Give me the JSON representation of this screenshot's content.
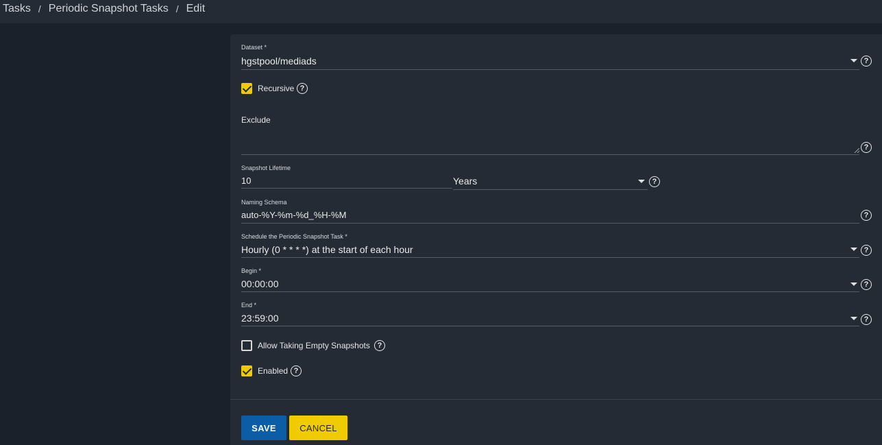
{
  "breadcrumb": {
    "items": [
      "Tasks",
      "Periodic Snapshot Tasks",
      "Edit"
    ],
    "separator": "/"
  },
  "form": {
    "dataset": {
      "label": "Dataset *",
      "value": "hgstpool/mediads"
    },
    "recursive": {
      "label": "Recursive",
      "checked": true
    },
    "exclude": {
      "label": "Exclude",
      "value": ""
    },
    "lifetime": {
      "label": "Snapshot Lifetime",
      "value": "10",
      "unit": "Years"
    },
    "naming": {
      "label": "Naming Schema",
      "value": "auto-%Y-%m-%d_%H-%M"
    },
    "schedule": {
      "label": "Schedule the Periodic Snapshot Task *",
      "value": "Hourly (0 * * * *) at the start of each hour"
    },
    "begin": {
      "label": "Begin *",
      "value": "00:00:00"
    },
    "end": {
      "label": "End *",
      "value": "23:59:00"
    },
    "allow_empty": {
      "label": "Allow Taking Empty Snapshots",
      "checked": false
    },
    "enabled": {
      "label": "Enabled",
      "checked": true
    }
  },
  "actions": {
    "save": "SAVE",
    "cancel": "CANCEL"
  },
  "icons": {
    "help": "help-circle-icon",
    "dropdown": "arrow-drop-down-icon",
    "check": "check-icon"
  },
  "colors": {
    "accent_yellow": "#f0cb00",
    "primary_blue": "#0b5ea5",
    "background": "#1b212a",
    "card": "#242b34"
  }
}
